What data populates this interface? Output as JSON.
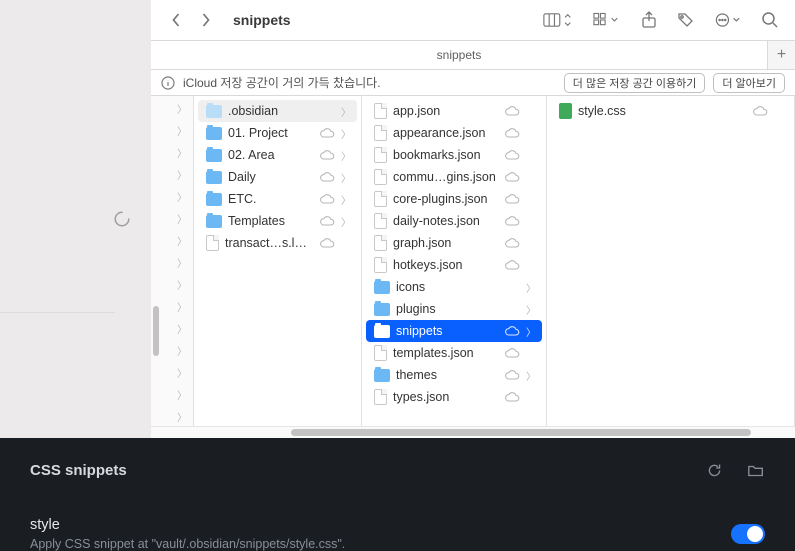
{
  "toolbar": {
    "title": "snippets"
  },
  "tab": {
    "label": "snippets"
  },
  "alert": {
    "message": "iCloud 저장 공간이 거의 가득 찼습니다.",
    "more_space": "더 많은 저장 공간 이용하기",
    "learn_more": "더 알아보기"
  },
  "col1": [
    {
      "name": ".obsidian",
      "type": "folder-light",
      "cloud": false,
      "chevron": true,
      "selected": true
    },
    {
      "name": "01. Project",
      "type": "folder",
      "cloud": true,
      "chevron": true,
      "selected": false
    },
    {
      "name": "02. Area",
      "type": "folder",
      "cloud": true,
      "chevron": true,
      "selected": false
    },
    {
      "name": "Daily",
      "type": "folder",
      "cloud": true,
      "chevron": true,
      "selected": false
    },
    {
      "name": "ETC.",
      "type": "folder",
      "cloud": true,
      "chevron": true,
      "selected": false
    },
    {
      "name": "Templates",
      "type": "folder",
      "cloud": true,
      "chevron": true,
      "selected": false
    },
    {
      "name": "transact…s.ledger",
      "type": "file",
      "cloud": true,
      "chevron": false,
      "selected": false
    }
  ],
  "col2": [
    {
      "name": "app.json",
      "type": "file",
      "cloud": true,
      "chevron": false,
      "selected": false
    },
    {
      "name": "appearance.json",
      "type": "file",
      "cloud": true,
      "chevron": false,
      "selected": false
    },
    {
      "name": "bookmarks.json",
      "type": "file",
      "cloud": true,
      "chevron": false,
      "selected": false
    },
    {
      "name": "commu…gins.json",
      "type": "file",
      "cloud": true,
      "chevron": false,
      "selected": false
    },
    {
      "name": "core-plugins.json",
      "type": "file",
      "cloud": true,
      "chevron": false,
      "selected": false
    },
    {
      "name": "daily-notes.json",
      "type": "file",
      "cloud": true,
      "chevron": false,
      "selected": false
    },
    {
      "name": "graph.json",
      "type": "file",
      "cloud": true,
      "chevron": false,
      "selected": false
    },
    {
      "name": "hotkeys.json",
      "type": "file",
      "cloud": true,
      "chevron": false,
      "selected": false
    },
    {
      "name": "icons",
      "type": "folder",
      "cloud": false,
      "chevron": true,
      "selected": false
    },
    {
      "name": "plugins",
      "type": "folder",
      "cloud": false,
      "chevron": true,
      "selected": false
    },
    {
      "name": "snippets",
      "type": "folder",
      "cloud": true,
      "chevron": true,
      "selected": true
    },
    {
      "name": "templates.json",
      "type": "file",
      "cloud": true,
      "chevron": false,
      "selected": false
    },
    {
      "name": "themes",
      "type": "folder",
      "cloud": true,
      "chevron": true,
      "selected": false
    },
    {
      "name": "types.json",
      "type": "file",
      "cloud": true,
      "chevron": false,
      "selected": false
    }
  ],
  "col3": [
    {
      "name": "style.css",
      "type": "css",
      "cloud": true,
      "chevron": false,
      "selected": false
    }
  ],
  "obsidian": {
    "heading": "CSS snippets",
    "item_name": "style",
    "item_desc": "Apply CSS snippet at \"vault/.obsidian/snippets/style.css\"."
  }
}
